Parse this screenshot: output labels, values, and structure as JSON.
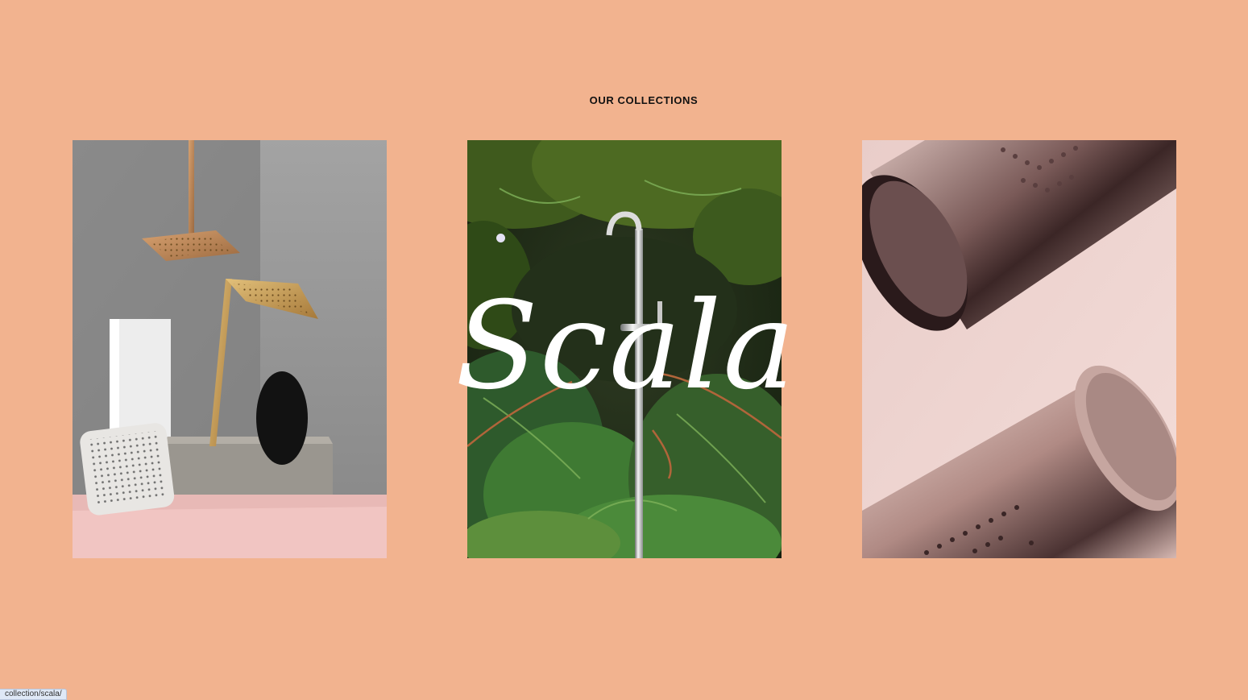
{
  "section": {
    "title": "OUR COLLECTIONS"
  },
  "collections": [
    {
      "image_subject": "brushed-gold shower heads on concrete blocks"
    },
    {
      "label": "Scala",
      "image_subject": "chrome tap among ferns"
    },
    {
      "image_subject": "rose-gold cylindrical shower heads"
    }
  ],
  "status_bar": {
    "url": "collection/scala/"
  },
  "colors": {
    "background": "#f2b38f",
    "heading": "#111111",
    "overlay_text": "#ffffff"
  }
}
